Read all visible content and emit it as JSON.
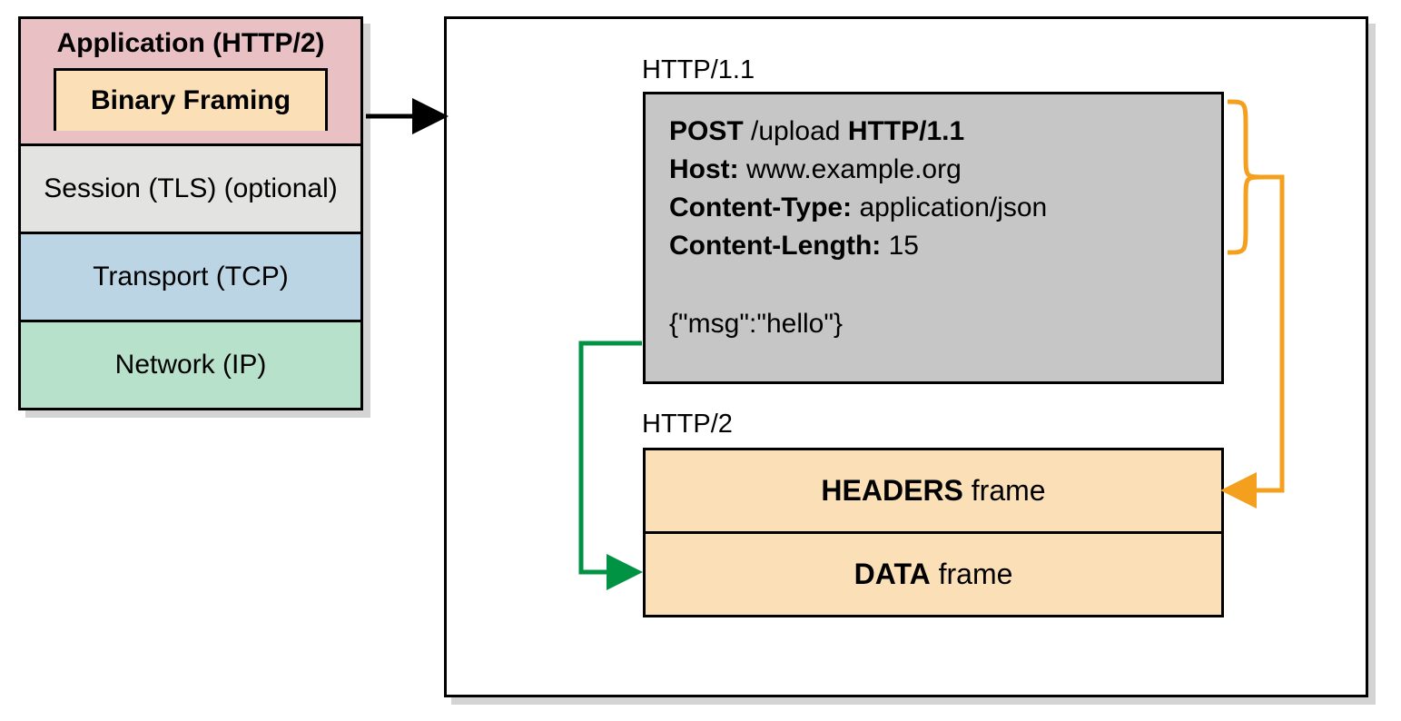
{
  "stack": {
    "app_title": "Application (HTTP/2)",
    "binary_framing": "Binary Framing",
    "session": "Session (TLS) (optional)",
    "transport": "Transport (TCP)",
    "network": "Network (IP)"
  },
  "http11": {
    "label": "HTTP/1.1",
    "method": "POST",
    "path": "/upload",
    "version": "HTTP/1.1",
    "host_label": "Host:",
    "host_value": "www.example.org",
    "ctype_label": "Content-Type:",
    "ctype_value": "application/json",
    "clen_label": "Content-Length:",
    "clen_value": "15",
    "body": "{\"msg\":\"hello\"}"
  },
  "http2": {
    "label": "HTTP/2",
    "headers_bold": "HEADERS",
    "headers_rest": "frame",
    "data_bold": "DATA",
    "data_rest": "frame"
  },
  "colors": {
    "app": "#e9c1c5",
    "framing": "#fbdfb6",
    "session": "#e3e3e2",
    "transport": "#bbd5e5",
    "network": "#b8e1cb",
    "http11box": "#c6c6c6",
    "orange": "#f4a01e",
    "green": "#009344"
  }
}
